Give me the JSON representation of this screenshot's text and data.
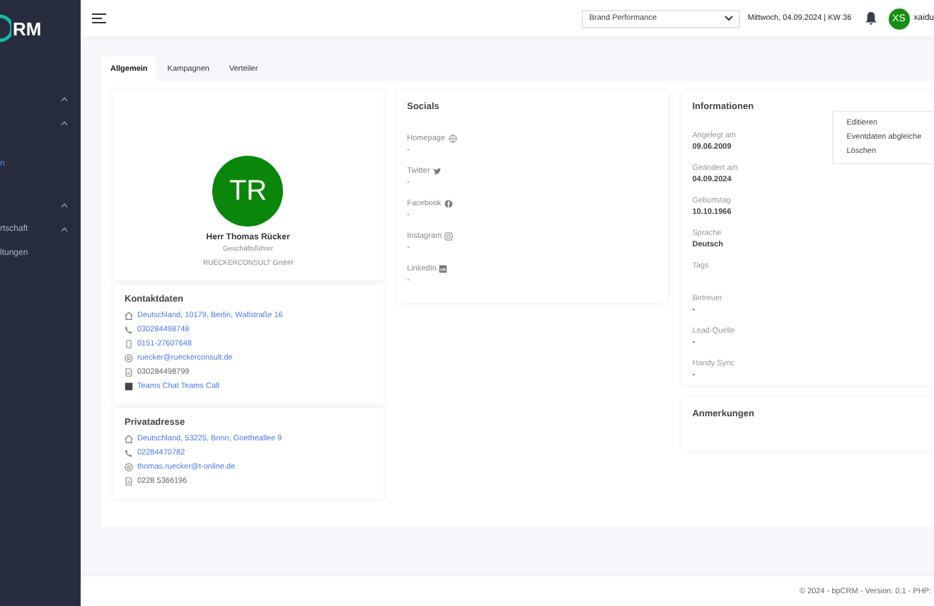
{
  "sidebar": {
    "logo": "RM",
    "items": [
      {
        "submenu": true,
        "selected": false
      },
      {
        "submenu": true,
        "selected": false
      },
      {
        "label": "n",
        "submenu": false,
        "selected": true
      },
      {
        "submenu": true,
        "selected": false
      },
      {
        "label": "rtschaft",
        "submenu": true,
        "selected": false
      },
      {
        "label": "ltungen",
        "submenu": false,
        "selected": false
      }
    ]
  },
  "header": {
    "select": "Brand Performance",
    "date": "Mittwoch, 04.09.2024 | KW 36",
    "user_initials": "XS",
    "user_name": "xaidu"
  },
  "tabs": [
    {
      "label": "Allgemein",
      "selected": true
    },
    {
      "label": "Kampagnen",
      "selected": false
    },
    {
      "label": "Verteiler",
      "selected": false
    }
  ],
  "profile": {
    "initials": "TR",
    "name": "Herr Thomas Rücker",
    "position": "Geschäftsführer",
    "company": "RUECKERCONSULT GmbH"
  },
  "contact": {
    "title": "Kontaktdaten",
    "rows": [
      {
        "kind": "address",
        "text": "Deutschland, 10179, Berlin, Wallstraße 16",
        "link": true
      },
      {
        "kind": "phone",
        "text": "030284498748",
        "link": true
      },
      {
        "kind": "mobile",
        "text": "0151-27607648",
        "link": true
      },
      {
        "kind": "email",
        "text": "ruecker@rueckerconsult.de",
        "link": true
      },
      {
        "kind": "fax",
        "text": "030284498799",
        "link": false
      },
      {
        "kind": "teams",
        "text": "Teams Chat Teams Call",
        "link": true
      }
    ]
  },
  "private": {
    "title": "Privatadresse",
    "rows": [
      {
        "kind": "address",
        "text": "Deutschland, 53225, Bonn, Goetheallee 9",
        "link": true
      },
      {
        "kind": "phone",
        "text": "02284470782",
        "link": true
      },
      {
        "kind": "email",
        "text": "thomas.ruecker@t-online.de",
        "link": true
      },
      {
        "kind": "fax",
        "text": "0228 5366196",
        "link": false
      }
    ]
  },
  "socials": {
    "title": "Socials",
    "items": [
      {
        "kind": "globe",
        "label": "Homepage",
        "value": "-"
      },
      {
        "kind": "twitter",
        "label": "Twitter",
        "value": "-"
      },
      {
        "kind": "facebook",
        "label": "Facebook",
        "value": "-"
      },
      {
        "kind": "instagram",
        "label": "Instagram",
        "value": "-"
      },
      {
        "kind": "linkedin",
        "label": "LinkedIn",
        "value": "-"
      }
    ]
  },
  "info": {
    "title": "Informationen",
    "fields": [
      {
        "label": "Angelegt am",
        "value": "09.06.2009"
      },
      {
        "label": "Geändert am",
        "value": "04.09.2024"
      },
      {
        "label": "Geburtstag",
        "value": "10.10.1966"
      },
      {
        "label": "Sprache",
        "value": "Deutsch"
      },
      {
        "label": "Tags"
      },
      {
        "label": "Betreuer",
        "value": "-"
      },
      {
        "label": "Lead-Quelle",
        "value": "-"
      },
      {
        "label": "Handy Sync",
        "value": "-"
      }
    ]
  },
  "menu": [
    "Editieren",
    "Eventdaten abgleiche",
    "Löschen"
  ],
  "notes": {
    "title": "Anmerkungen"
  },
  "footer": "© 2024 - bpCRM - Version: 0.1 - PHP:"
}
